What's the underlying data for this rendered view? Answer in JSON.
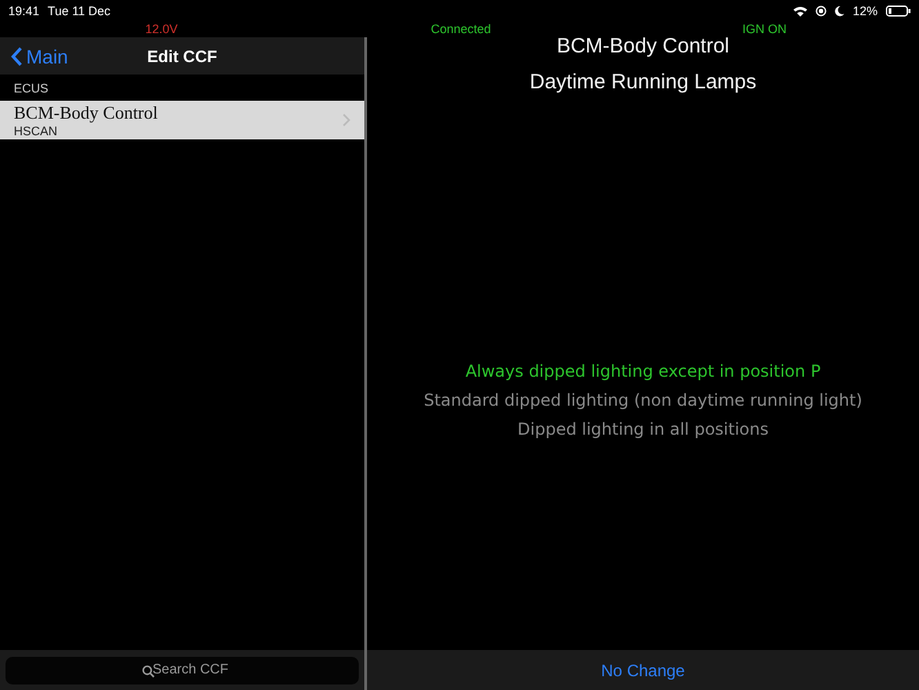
{
  "status_bar": {
    "time": "19:41",
    "date": "Tue 11 Dec",
    "battery": "12%"
  },
  "indicators": {
    "voltage": "12.0V",
    "connection": "Connected",
    "ignition": "IGN ON"
  },
  "nav": {
    "back": "Main",
    "title": "Edit CCF"
  },
  "section_header": "ECUS",
  "ecus": [
    {
      "name": "BCM-Body Control",
      "bus": "HSCAN",
      "selected": true
    }
  ],
  "search": {
    "placeholder": "Search CCF"
  },
  "detail": {
    "module": "BCM-Body Control",
    "setting": "Daytime Running Lamps",
    "options": [
      {
        "label": "Always dipped lighting except in position P",
        "selected": true
      },
      {
        "label": "Standard dipped lighting (non daytime running light)",
        "selected": false
      },
      {
        "label": "Dipped lighting in all positions",
        "selected": false
      }
    ],
    "action": "No Change"
  }
}
